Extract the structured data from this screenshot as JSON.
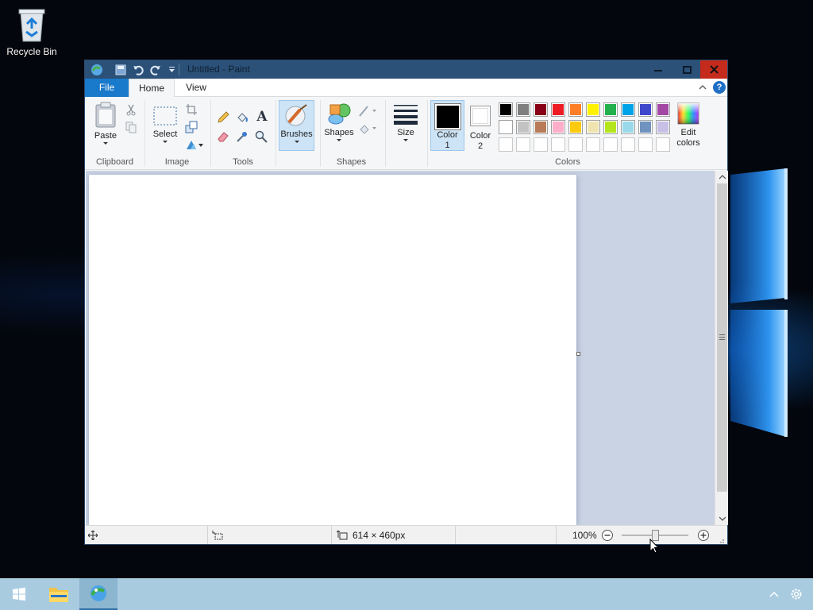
{
  "desktop": {
    "recycle_bin_label": "Recycle Bin"
  },
  "paint": {
    "title": "Untitled - Paint",
    "tabs": {
      "file": "File",
      "home": "Home",
      "view": "View"
    },
    "help_label": "?",
    "ribbon": {
      "clipboard": {
        "paste": "Paste",
        "group": "Clipboard"
      },
      "image": {
        "select": "Select",
        "group": "Image"
      },
      "tools": {
        "group": "Tools",
        "text_tool": "A"
      },
      "brushes": "Brushes",
      "shapes": {
        "label": "Shapes",
        "group": "Shapes"
      },
      "size": "Size",
      "colors": {
        "color1_line1": "Color",
        "color1_line2": "1",
        "color2_line1": "Color",
        "color2_line2": "2",
        "edit_line1": "Edit",
        "edit_line2": "colors",
        "group": "Colors",
        "color1": "#000000",
        "color2": "#ffffff",
        "palette_row1": [
          "#000000",
          "#7f7f7f",
          "#880015",
          "#ed1c24",
          "#ff7f27",
          "#fff200",
          "#22b14c",
          "#00a2e8",
          "#3f48cc",
          "#a349a4"
        ],
        "palette_row2": [
          "#ffffff",
          "#c3c3c3",
          "#b97a57",
          "#ffaec9",
          "#ffc90e",
          "#efe4b0",
          "#b5e61d",
          "#99d9ea",
          "#7092be",
          "#c8bfe7"
        ],
        "palette_row3": [
          "#ffffff",
          "#ffffff",
          "#ffffff",
          "#ffffff",
          "#ffffff",
          "#ffffff",
          "#ffffff",
          "#ffffff",
          "#ffffff",
          "#ffffff"
        ]
      }
    },
    "status": {
      "canvas_size": "614 × 460px",
      "zoom": "100%",
      "zoom_level": 1.0
    }
  },
  "colors": {
    "titlebar": "#2b5179",
    "file_tab": "#1979ca",
    "close_button": "#c42b1c",
    "taskbar": "#a9cbe0"
  }
}
